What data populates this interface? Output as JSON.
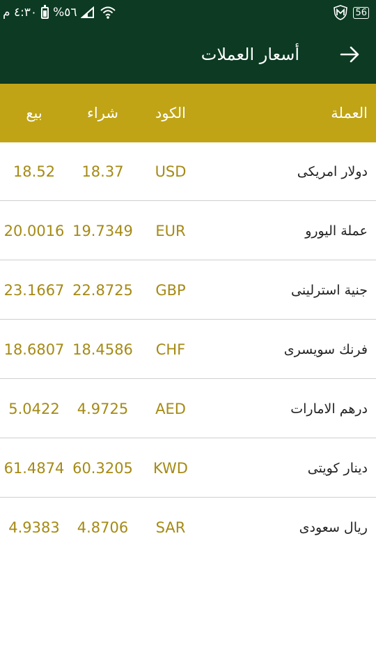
{
  "status": {
    "time": "٤:٣٠ م",
    "battery": "%٥٦",
    "badge": "56"
  },
  "appbar": {
    "title": "أسعار العملات",
    "back_icon": "arrow-right-icon"
  },
  "table": {
    "headers": {
      "currency": "العملة",
      "code": "الكود",
      "buy": "شراء",
      "sell": "بيع"
    },
    "rows": [
      {
        "name": "دولار امريكى",
        "code": "USD",
        "buy": "18.37",
        "sell": "18.52"
      },
      {
        "name": "عملة اليورو",
        "code": "EUR",
        "buy": "19.7349",
        "sell": "20.0016"
      },
      {
        "name": "جنية استرلينى",
        "code": "GBP",
        "buy": "22.8725",
        "sell": "23.1667"
      },
      {
        "name": "فرنك سويسرى",
        "code": "CHF",
        "buy": "18.4586",
        "sell": "18.6807"
      },
      {
        "name": "درهم الامارات",
        "code": "AED",
        "buy": "4.9725",
        "sell": "5.0422"
      },
      {
        "name": "دينار كويتى",
        "code": "KWD",
        "buy": "60.3205",
        "sell": "61.4874"
      },
      {
        "name": "ريال سعودى",
        "code": "SAR",
        "buy": "4.8706",
        "sell": "4.9383"
      }
    ]
  },
  "colors": {
    "primary": "#0c3a22",
    "accent": "#c0a416",
    "value_text": "#a58a15"
  }
}
